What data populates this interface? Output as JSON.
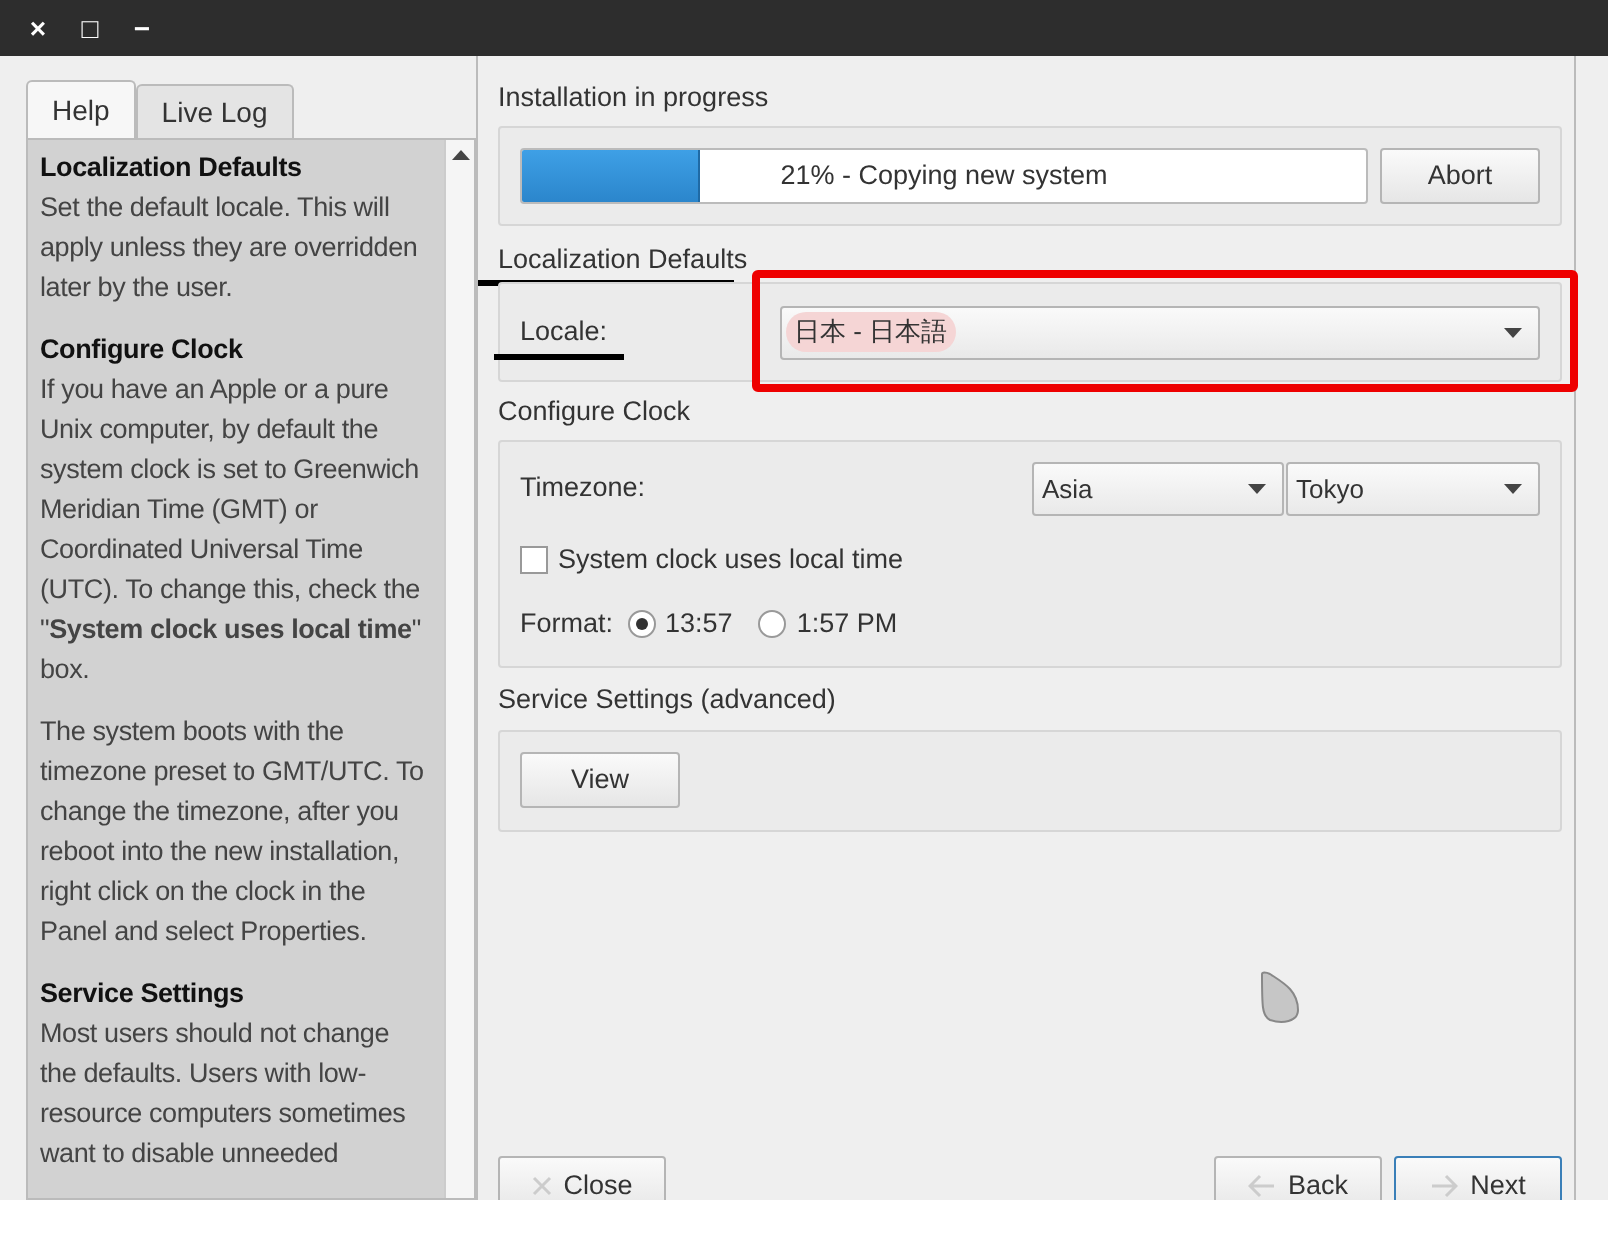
{
  "window": {
    "buttons": [
      "×",
      "□",
      "−"
    ]
  },
  "tabs": [
    {
      "label": "Help",
      "selected": true
    },
    {
      "label": "Live Log",
      "selected": false
    }
  ],
  "help": [
    {
      "heading": "Localization Defaults",
      "paragraphs": [
        "Set the default locale. This will apply unless they are overridden later by the user."
      ]
    },
    {
      "heading": "Configure Clock",
      "paragraphs": [
        "If you have an Apple or a pure Unix computer, by default the system clock is set to Greenwich Meridian Time (GMT) or Coordinated Universal Time (UTC). To change this, check the \"**System clock uses local time**\" box.",
        "The system boots with the timezone preset to GMT/UTC. To change the timezone, after you reboot into the new installation, right click on the clock in the Panel and select Properties."
      ]
    },
    {
      "heading": "Service Settings",
      "paragraphs": [
        "Most users should not change the defaults. Users with low-resource computers sometimes want to disable unneeded"
      ]
    }
  ],
  "progress": {
    "title": "Installation in progress",
    "level": 0.21,
    "text": "21% - Copying new system",
    "button": "Abort"
  },
  "localization": {
    "title": "Localization Defaults",
    "title_underlined": true,
    "label": "Locale:",
    "label_underlined": true,
    "value": "日本 - 日本語",
    "value_highlighted": true,
    "framed": true
  },
  "clock": {
    "title": "Configure Clock",
    "timezone_label": "Timezone:",
    "region": "Asia",
    "city": "Tokyo",
    "local_time": {
      "label": "System clock uses local time",
      "checked": false
    },
    "format_label": "Format:",
    "formats": [
      {
        "label": "13:57",
        "selected": true
      },
      {
        "label": "1:57 PM",
        "selected": false
      }
    ]
  },
  "services": {
    "title": "Service Settings (advanced)",
    "button": "View"
  },
  "footer": [
    {
      "label": "Close",
      "kind": "close"
    },
    {
      "label": "Back",
      "kind": "back"
    },
    {
      "label": "Next",
      "kind": "next"
    }
  ]
}
